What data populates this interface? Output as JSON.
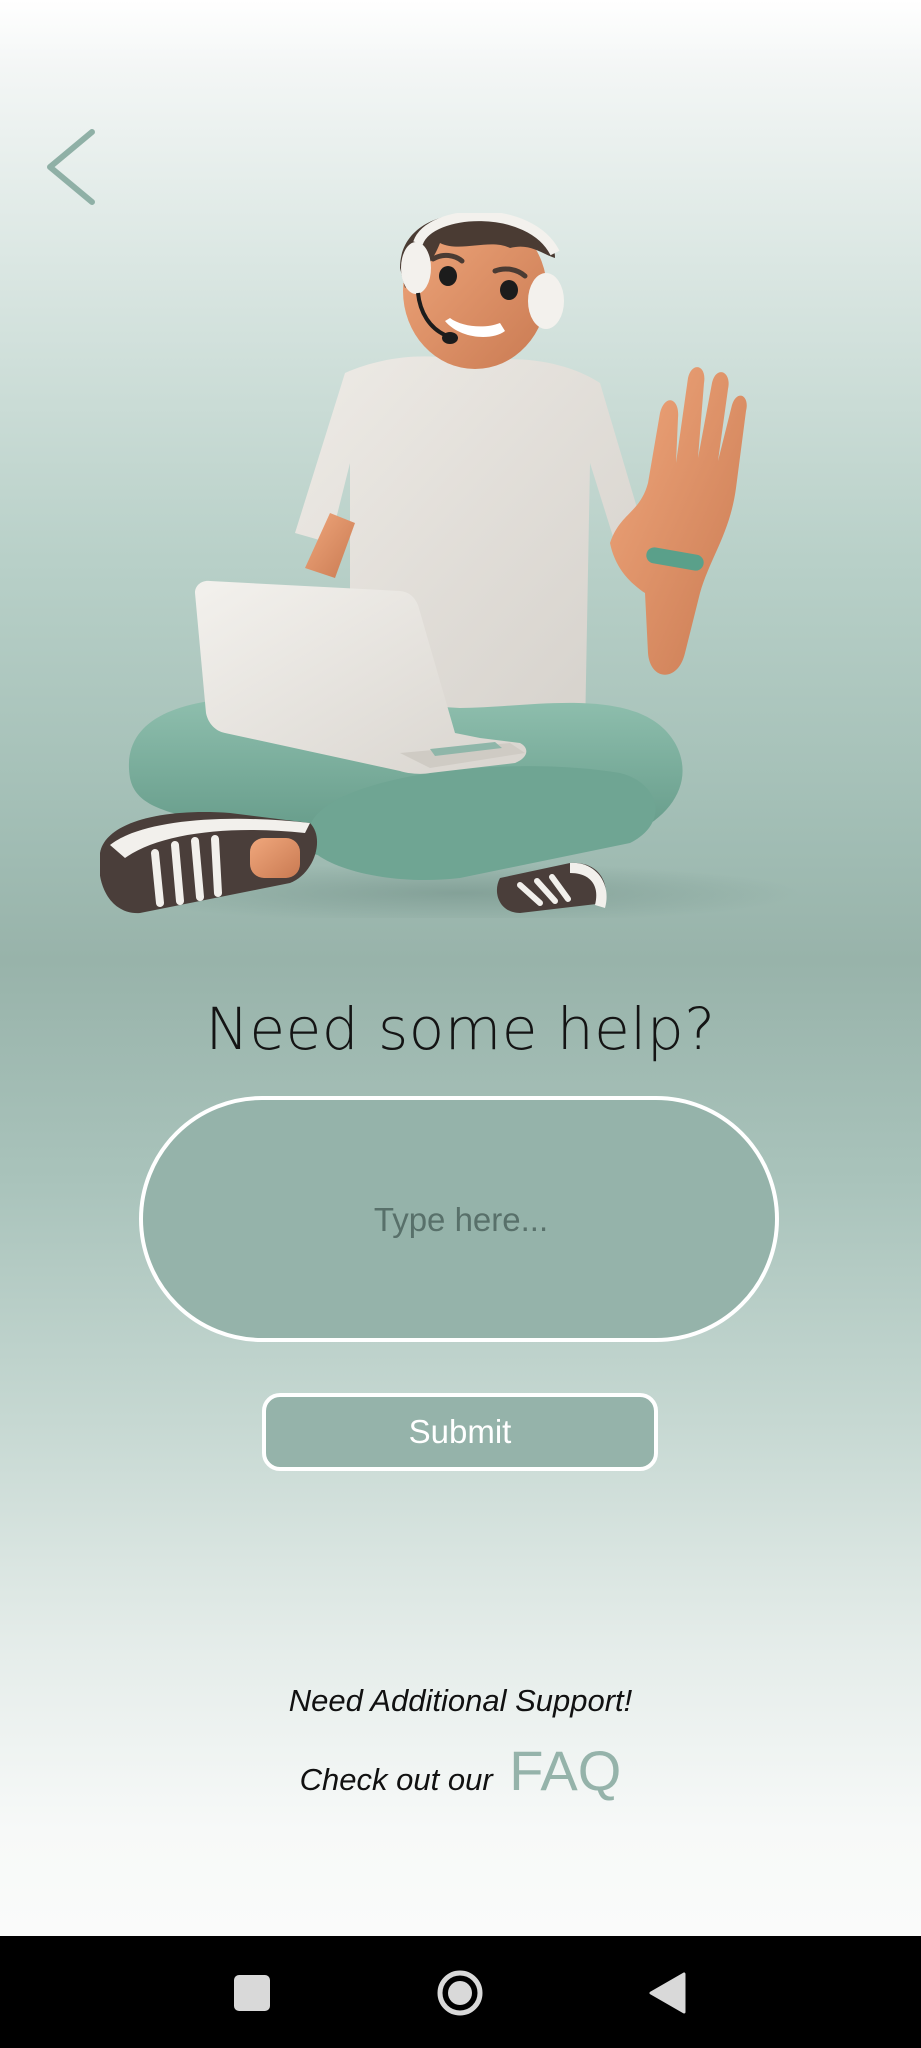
{
  "header": {
    "back_icon": "chevron-left-icon"
  },
  "hero": {
    "illustration": "support-agent-with-headset-and-laptop"
  },
  "main": {
    "title": "Need some help?",
    "input_placeholder": "Type here...",
    "input_value": "",
    "submit_label": "Submit"
  },
  "footer": {
    "support_text": "Need Additional Support!",
    "faq_prefix": "Check out our",
    "faq_link": "FAQ"
  },
  "system_nav": {
    "recents_icon": "square-icon",
    "home_icon": "circle-home-icon",
    "back_icon": "triangle-back-icon"
  },
  "colors": {
    "accent": "#95b3aa",
    "text": "#141414",
    "white": "#ffffff",
    "navbar": "#000000"
  }
}
